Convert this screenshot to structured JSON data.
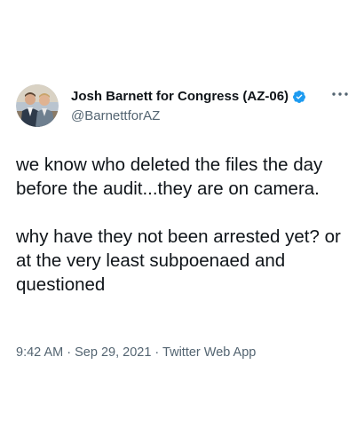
{
  "author": {
    "display_name": "Josh Barnett for Congress (AZ-06)",
    "handle": "@BarnettforAZ",
    "verified": true,
    "avatar_icon": "profile-photo-avatar"
  },
  "tweet": {
    "paragraphs": [
      "we know who deleted the files the day before the audit...they are on camera.",
      "why have they not been arrested yet? or at the very least subpoenaed and questioned"
    ],
    "time": "9:42 AM",
    "separator": "·",
    "date": "Sep 29, 2021",
    "source": "Twitter Web App"
  },
  "icons": {
    "verified": "verified-badge-icon",
    "more": "more-options-icon"
  },
  "colors": {
    "text": "#0f1419",
    "secondary": "#536471",
    "verified_blue": "#1d9bf0",
    "background": "#ffffff"
  }
}
